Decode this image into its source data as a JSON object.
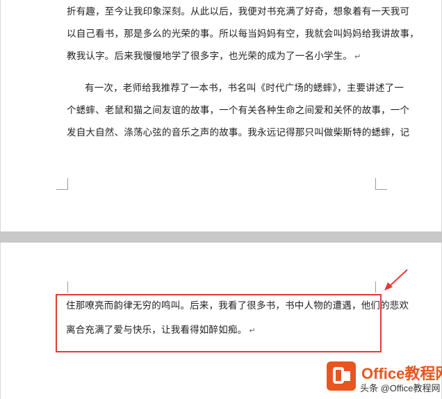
{
  "page_top": {
    "lines": [
      "折有趣，至今让我印象深刻。从此以后，我便对书充满了好奇，想象着有一天我可",
      "以自己看书，那是多么的光荣的事。所以每当妈妈有空，我就会叫妈妈给我讲故事，",
      "教我认字。后来我慢慢地学了很多字，也光荣的成为了一名小学生。",
      "有一次，老师给我推荐了一本书，书名叫《时代广场的蟋蟀》，主要讲述了一",
      "个蟋蟀、老鼠和猫之间友谊的故事，一个有关各种生命之间爱和关怀的故事，一个",
      "发自大自然、涤荡心弦的音乐之声的故事。我永远记得那只叫做柴斯特的蟋蟀，记"
    ]
  },
  "page_bottom": {
    "lines": [
      "住那嘹亮而韵律无穷的鸣叫。后来，我看了很多书，书中人物的遭遇，他们的悲欢",
      "离合充满了爱与快乐，让我看得如醉如痴。"
    ]
  },
  "paragraph_mark": "↵",
  "watermark": {
    "title": "Office教程网",
    "subtitle": "头条 @Office教程网",
    "icon": "office-logo-icon"
  },
  "colors": {
    "highlight": "#e53935",
    "brand": "#e8551f",
    "gap": "#c8c8c8"
  }
}
